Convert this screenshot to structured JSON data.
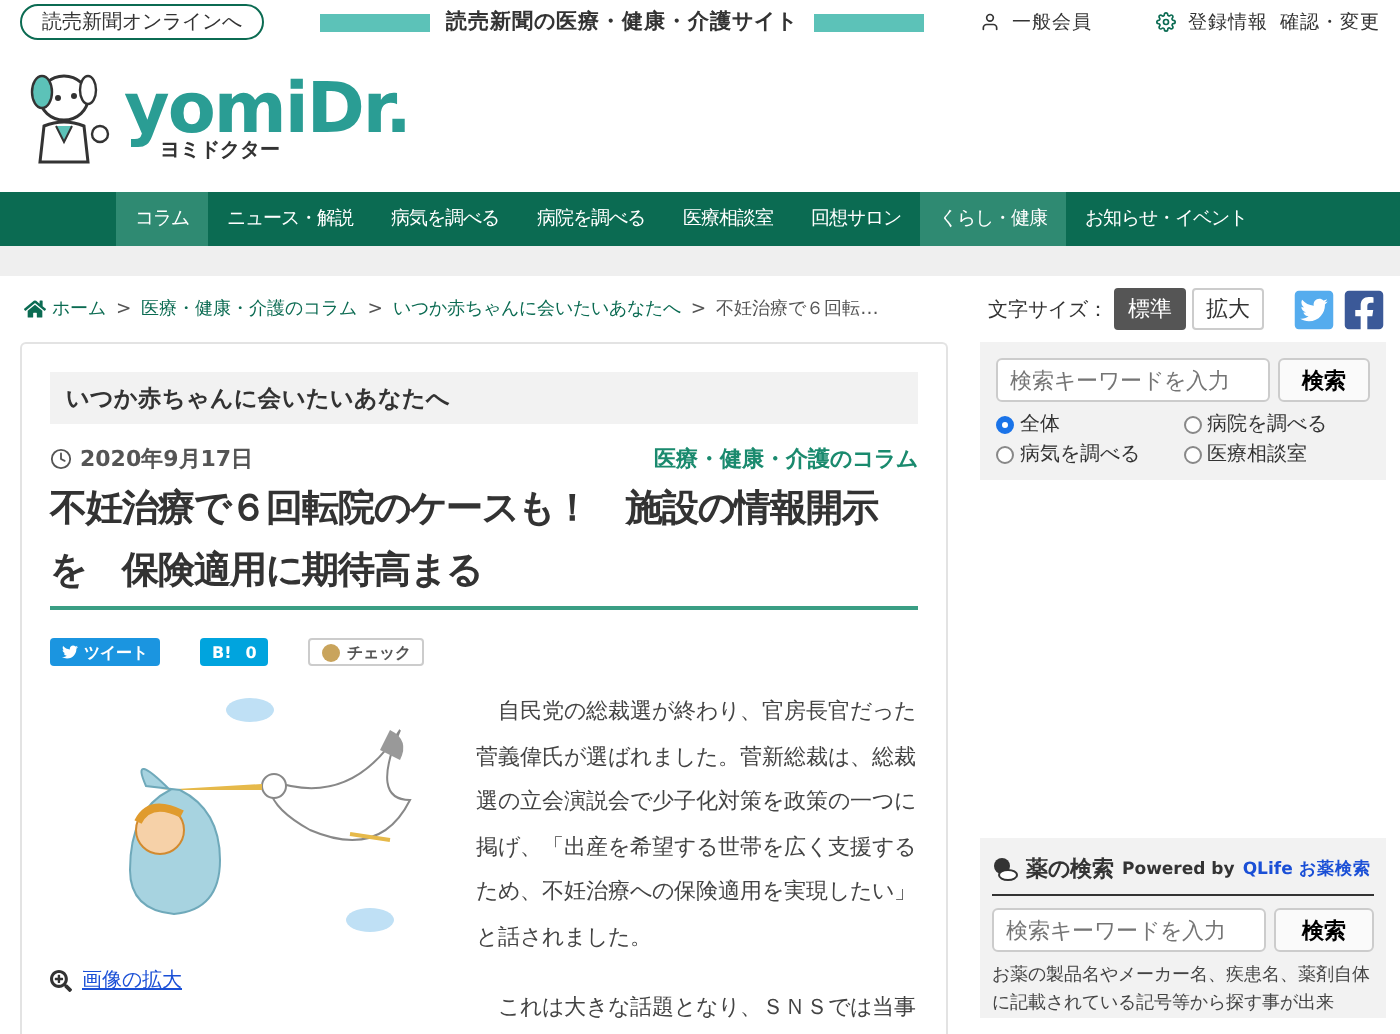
{
  "top_bar": {
    "online_link": "読売新聞オンラインへ",
    "site_tagline": "読売新聞の医療・健康・介護サイト",
    "member": "一般会員",
    "account_links": [
      "登録情報",
      "確認・変更"
    ]
  },
  "logo": {
    "name": "yomiDr.",
    "reading": "ヨミドクター"
  },
  "nav": [
    {
      "label": "コラム",
      "selected": true
    },
    {
      "label": "ニュース・解説",
      "selected": false
    },
    {
      "label": "病気を調べる",
      "selected": false
    },
    {
      "label": "病院を調べる",
      "selected": false
    },
    {
      "label": "医療相談室",
      "selected": false
    },
    {
      "label": "回想サロン",
      "selected": false
    },
    {
      "label": "くらし・健康",
      "selected": true
    },
    {
      "label": "お知らせ・イベント",
      "selected": false
    }
  ],
  "breadcrumb_separator": ">",
  "breadcrumb": [
    "ホーム",
    "医療・健康・介護のコラム",
    "いつか赤ちゃんに会いたいあなたへ",
    "不妊治療で６回転…"
  ],
  "font_size": {
    "label": "文字サイズ：",
    "options": [
      {
        "label": "標準",
        "selected": true
      },
      {
        "label": "拡大",
        "selected": false
      }
    ]
  },
  "article": {
    "series": "いつか赤ちゃんに会いたいあなたへ",
    "date": "2020年9月17日",
    "category": "医療・健康・介護のコラム",
    "title": "不妊治療で６回転院のケースも！　施設の情報開示を　保険適用に期待高まる",
    "share": [
      {
        "kind": "tweet",
        "label": "ツイート"
      },
      {
        "kind": "hatena",
        "label": "B!",
        "count": "0"
      },
      {
        "kind": "check",
        "label": "チェック"
      }
    ],
    "image_link": "画像の拡大",
    "paragraphs": [
      "自民党の総裁選が終わり、官房長官だった菅義偉氏が選ばれました。菅新総裁は、総裁選の立会演説会で少子化対策を政策の一つに掲げ、「出産を希望する世帯を広く支援するため、不妊治療への保険適用を実現したい」と話されました。",
      "これは大きな話題となり、ＳＮＳでは当事"
    ]
  },
  "site_search": {
    "placeholder": "検索キーワードを入力",
    "button": "検索",
    "scopes": [
      {
        "label": "全体",
        "selected": true
      },
      {
        "label": "病院を調べる",
        "selected": false
      },
      {
        "label": "病気を調べる",
        "selected": false
      },
      {
        "label": "医療相談室",
        "selected": false
      }
    ]
  },
  "drug_search": {
    "title": "薬の検索",
    "powered_by": "Powered by",
    "provider": "QLife お薬検索",
    "placeholder": "検索キーワードを入力",
    "button": "検索",
    "description": "お薬の製品名やメーカー名、疾患名、薬剤自体に記載されている記号等から探す事が出来"
  }
}
